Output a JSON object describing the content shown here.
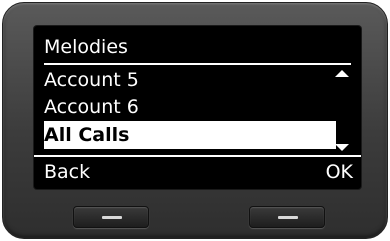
{
  "screen": {
    "title": "Melodies",
    "items": [
      {
        "label": "Account 5",
        "selected": false
      },
      {
        "label": "Account 6",
        "selected": false
      },
      {
        "label": "All Calls",
        "selected": true
      }
    ],
    "scroll": {
      "up_icon": "triangle-up-icon",
      "down_icon": "triangle-down-icon"
    },
    "softkeys": {
      "left": "Back",
      "right": "OK"
    }
  },
  "hardware": {
    "left_key_icon": "minus-icon",
    "right_key_icon": "minus-icon"
  },
  "colors": {
    "screen_bg": "#000000",
    "text": "#ffffff",
    "selection_bg": "#ffffff",
    "selection_text": "#000000",
    "device_body": "#4a4a4a"
  }
}
